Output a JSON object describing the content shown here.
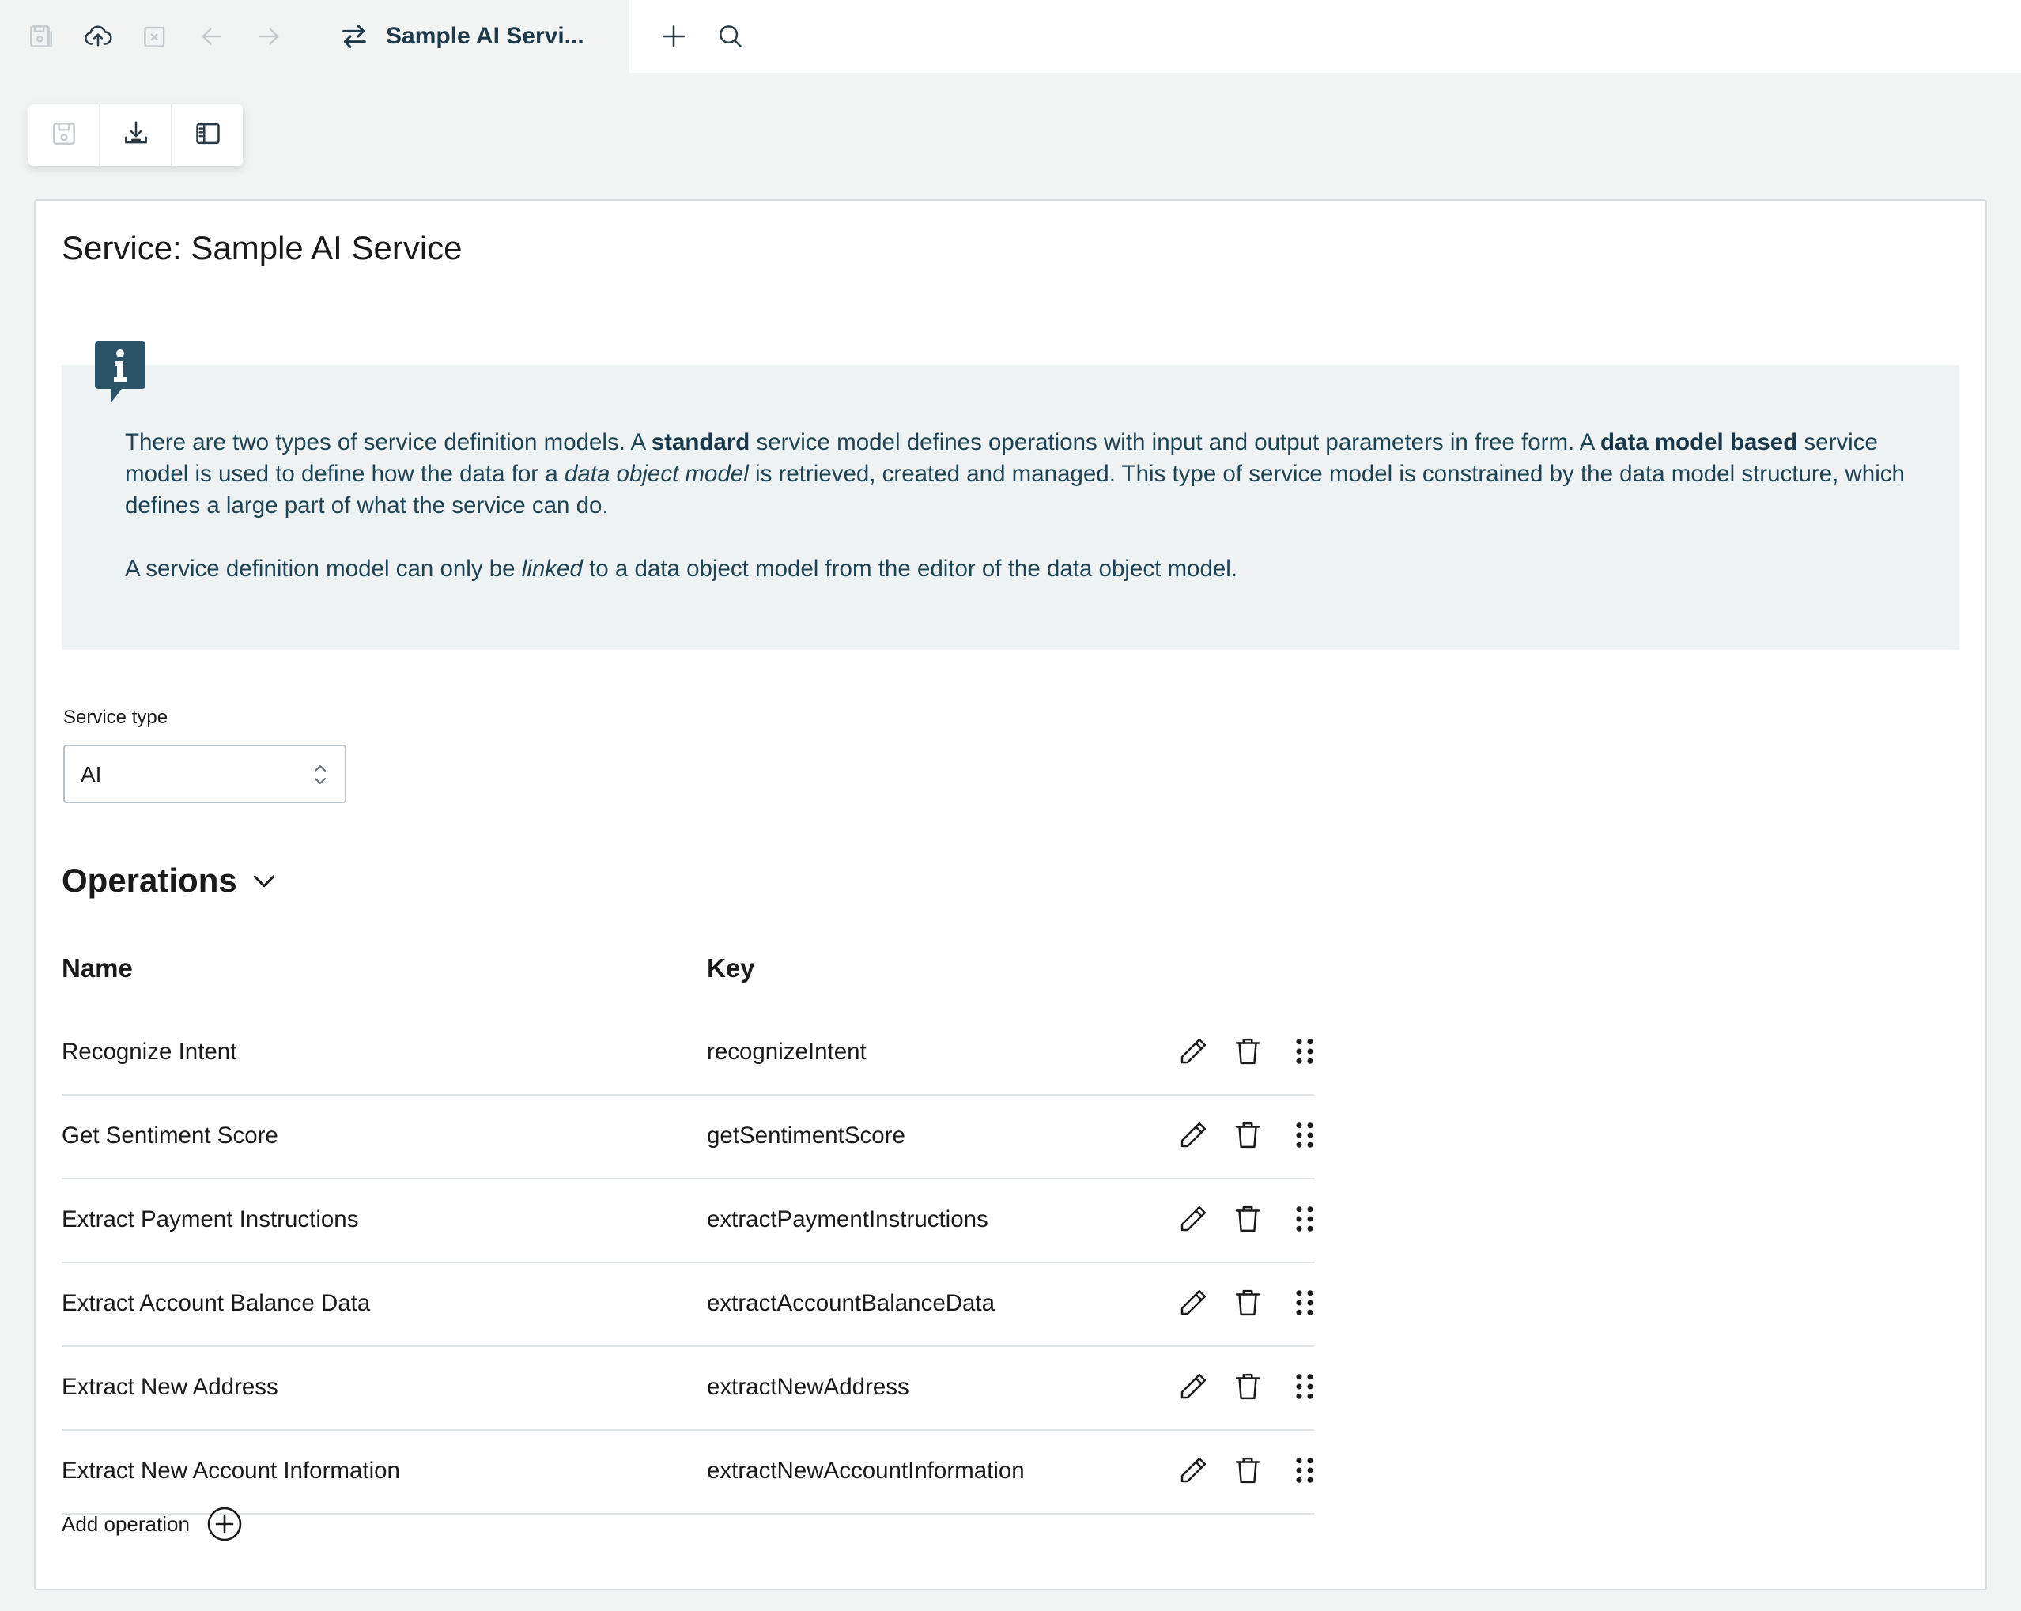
{
  "topbar": {
    "icons": [
      "save-icon",
      "cloud-upload-icon",
      "close-file-icon",
      "arrow-left-icon",
      "arrow-right-icon"
    ],
    "active_tab": {
      "icon": "swap-arrows-icon",
      "label": "Sample AI Servi..."
    },
    "new_tab_icon": "plus-icon",
    "search_icon": "search-icon"
  },
  "toolbox": {
    "items": [
      "save-icon",
      "download-icon",
      "panel-toggle-icon"
    ]
  },
  "page": {
    "title": "Service: Sample AI Service"
  },
  "info": {
    "icon": "info-icon",
    "p1_a": "There are two types of service definition models. A ",
    "p1_b": "standard",
    "p1_c": " service model defines operations with input and output parameters in free form. A ",
    "p1_d": "data model based",
    "p1_e": " service model is used to define how the data for a ",
    "p1_f": "data object model",
    "p1_g": " is retrieved, created and managed. This type of service model is constrained by the data model structure, which defines a large part of what the service can do.",
    "p2_a": "A service definition model can only be ",
    "p2_b": "linked",
    "p2_c": " to a data object model from the editor of the data object model."
  },
  "service_type": {
    "label": "Service type",
    "value": "AI"
  },
  "operations": {
    "heading": "Operations",
    "columns": {
      "name": "Name",
      "key": "Key"
    },
    "rows": [
      {
        "name": "Recognize Intent",
        "key": "recognizeIntent"
      },
      {
        "name": "Get Sentiment Score",
        "key": "getSentimentScore"
      },
      {
        "name": "Extract Payment Instructions",
        "key": "extractPaymentInstructions"
      },
      {
        "name": "Extract Account Balance Data",
        "key": "extractAccountBalanceData"
      },
      {
        "name": "Extract New Address",
        "key": "extractNewAddress"
      },
      {
        "name": "Extract New Account Information",
        "key": "extractNewAccountInformation"
      }
    ],
    "add_label": "Add operation"
  },
  "colors": {
    "accent": "#2b5468",
    "info_bg": "#eef2f3",
    "page_bg": "#f2f4f4",
    "icon_disabled": "#c4c9cc"
  }
}
